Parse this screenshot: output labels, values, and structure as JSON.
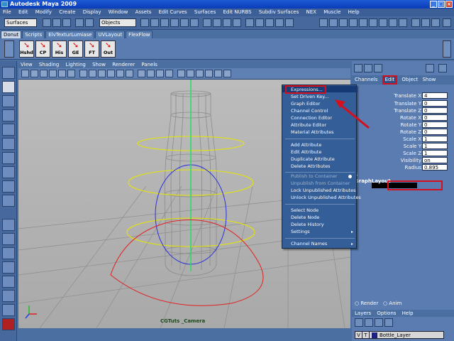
{
  "window": {
    "title": "Autodesk Maya 2009"
  },
  "menubar": [
    "File",
    "Edit",
    "Modify",
    "Create",
    "Display",
    "Window",
    "Assets",
    "Edit Curves",
    "Surfaces",
    "Edit NURBS",
    "Subdiv Surfaces",
    "NEX",
    "Muscle",
    "Help"
  ],
  "status_line": {
    "menu_set": "Surfaces",
    "selection_mode": "Objects"
  },
  "shelf_tabs": [
    {
      "label": "Donut",
      "active": true
    },
    {
      "label": "Scripts",
      "active": false
    },
    {
      "label": "ElvTexturLumiase",
      "active": false
    },
    {
      "label": "UVLayout",
      "active": false
    },
    {
      "label": "FlexFlow",
      "active": false
    }
  ],
  "shelf_buttons": [
    "Hshd",
    "CP",
    "His",
    "GE",
    "FT",
    "Out"
  ],
  "panel_menu": [
    "View",
    "Shading",
    "Lighting",
    "Show",
    "Renderer",
    "Panels"
  ],
  "viewport": {
    "camera_label": "CGTuts _Camera"
  },
  "channel_box": {
    "header": [
      "Channels",
      "Edit",
      "Object",
      "Show"
    ],
    "attributes": [
      {
        "name": "Translate X",
        "value": "4"
      },
      {
        "name": "Translate Y",
        "value": "0"
      },
      {
        "name": "Translate Z",
        "value": "0"
      },
      {
        "name": "Rotate X",
        "value": "0"
      },
      {
        "name": "Rotate Y",
        "value": "0"
      },
      {
        "name": "Rotate Z",
        "value": "0"
      },
      {
        "name": "Scale X",
        "value": "1"
      },
      {
        "name": "Scale Y",
        "value": "1"
      },
      {
        "name": "Scale Z",
        "value": "1"
      },
      {
        "name": "Visibility",
        "value": "on"
      },
      {
        "name": "Radius",
        "value": "0.895"
      }
    ],
    "section_s": "S",
    "graph_layout": "GraphLayout"
  },
  "render_row": {
    "render": "Render",
    "anim": "Anim"
  },
  "layer_editor": {
    "menu": [
      "Layers",
      "Options",
      "Help"
    ],
    "layer": {
      "visible": "V",
      "type": "T",
      "name": "Bottle_Layer"
    }
  },
  "context_menu": {
    "items": [
      {
        "label": "Expressions...",
        "highlighted": true
      },
      {
        "label": "Set Driven Key..."
      },
      {
        "label": "Graph Editor"
      },
      {
        "label": "Channel Control"
      },
      {
        "label": "Connection Editor"
      },
      {
        "label": "Attribute Editor"
      },
      {
        "label": "Material Attributes"
      },
      {
        "label": "Add Attribute"
      },
      {
        "label": "Edit Attribute"
      },
      {
        "label": "Duplicate Attribute"
      },
      {
        "label": "Delete Attributes"
      },
      {
        "label": "Publish to Container",
        "disabled": true
      },
      {
        "label": "Unpublish from Container",
        "disabled": true
      },
      {
        "label": "Lock Unpublished Attributes"
      },
      {
        "label": "Unlock Unpublished Attributes"
      },
      {
        "label": "Select Node"
      },
      {
        "label": "Delete Node"
      },
      {
        "label": "Delete History"
      },
      {
        "label": "Settings"
      },
      {
        "label": "Channel Names"
      }
    ]
  },
  "colors": {
    "highlight_red": "#d4101e",
    "panel_blue": "#4a6fa0",
    "menu_blue": "#345e97"
  }
}
